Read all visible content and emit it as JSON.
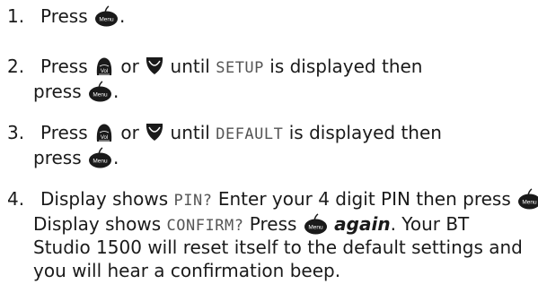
{
  "steps": [
    {
      "number": "1.",
      "parts": {
        "press": "Press",
        "end": "."
      }
    },
    {
      "number": "2.",
      "parts": {
        "press": "Press",
        "or": "or",
        "until": "until",
        "display_text": "SETUP",
        "rest": "is displayed then",
        "press2": "press",
        "end": "."
      }
    },
    {
      "number": "3.",
      "parts": {
        "press": "Press",
        "or": "or",
        "until": "until",
        "display_text": "DEFAULT",
        "rest": "is displayed then",
        "press2": "press",
        "end": "."
      }
    },
    {
      "number": "4.",
      "parts": {
        "display_shows_1": "Display shows",
        "display_text_1": "PIN?",
        "enter_text": "Enter your 4 digit PIN then press",
        "end1": ".",
        "display_shows_2": "Display shows",
        "display_text_2": "CONFIRM?",
        "press": "Press",
        "again": "again",
        "after_again": ". Your BT",
        "line3": "Studio 1500 will reset itself to the default settings and",
        "line4": "you will hear a confirmation beep."
      }
    }
  ],
  "icons": {
    "menu_label": "Menu",
    "vol_label": "Vol"
  },
  "colors": {
    "text": "#1a1a1a",
    "icon_fill": "#1a1a1a",
    "lcd_text": "#555555"
  }
}
